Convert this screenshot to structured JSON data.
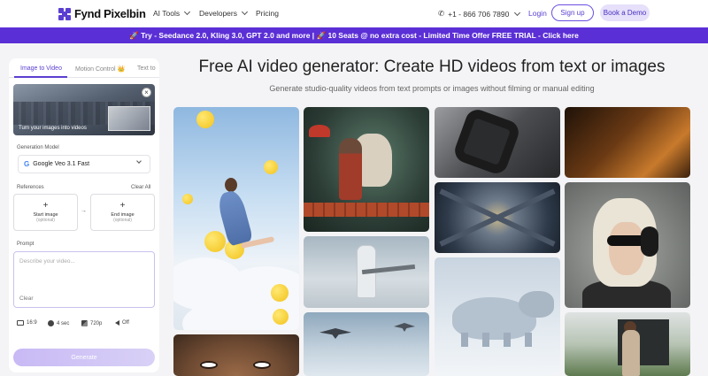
{
  "header": {
    "brand": "Fynd Pixelbin",
    "nav": [
      {
        "label": "AI Tools"
      },
      {
        "label": "Developers"
      },
      {
        "label": "Pricing"
      }
    ],
    "phone": "+1 - 866 706 7890",
    "login": "Login",
    "signup": "Sign up",
    "demo": "Book a Demo"
  },
  "banner": {
    "text": "🚀 Try - Seedance 2.0, Kling 3.0, GPT 2.0 and more | 🚀 10 Seats @ no extra cost - Limited Time Offer   FREE TRIAL - Click here"
  },
  "panel": {
    "tabs": [
      {
        "label": "Image to Video"
      },
      {
        "label": "Motion Control 👑"
      },
      {
        "label": "Text to"
      }
    ],
    "hero_caption": "Turn your images into videos",
    "model_label": "Generation Model",
    "model_value": "Google Veo 3.1 Fast",
    "references_label": "References",
    "clear_all": "Clear All",
    "start_image": {
      "plus": "+",
      "title": "Start image",
      "sub": "(optional)"
    },
    "end_image": {
      "plus": "+",
      "title": "End image",
      "sub": "(optional)"
    },
    "arrow": "→",
    "prompt_label": "Prompt",
    "prompt_placeholder": "Describe your video...",
    "prompt_clear": "Clear",
    "options": {
      "ratio": "16:9",
      "duration": "4 sec",
      "resolution": "720p",
      "audio": "Off"
    },
    "generate": "Generate"
  },
  "main": {
    "title": "Free AI video generator: Create HD videos from text or images",
    "subtitle": "Generate studio-quality videos from text prompts or images without filming or manual editing"
  },
  "colors": {
    "accent": "#5b3fd1",
    "banner": "#5b2fd6",
    "background": "#f4f4f6"
  }
}
